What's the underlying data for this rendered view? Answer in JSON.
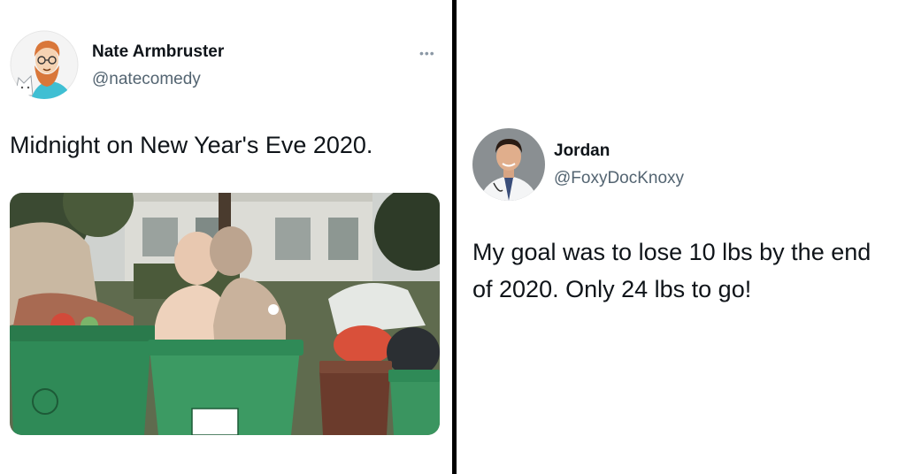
{
  "left_tweet": {
    "display_name": "Nate Armbruster",
    "handle": "@natecomedy",
    "more_icon": "•••",
    "text": "Midnight on New Year's Eve 2020.",
    "avatar_icon": "cartoon-avatar-icon",
    "media_icon": "photo-mannequins-in-trash-bins"
  },
  "right_tweet": {
    "display_name": "Jordan",
    "handle": "@FoxyDocKnoxy",
    "text": "My goal was to lose 10 lbs by the end of 2020. Only 24 lbs to go!",
    "avatar_icon": "doctor-photo-avatar-icon"
  },
  "colors": {
    "text_primary": "#0f1419",
    "text_secondary": "#536471",
    "divider": "#000000",
    "bin_green": "#2f8a57"
  }
}
